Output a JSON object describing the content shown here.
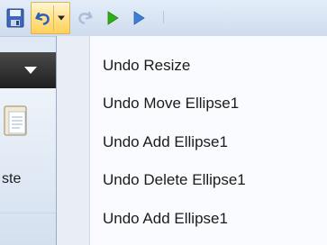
{
  "toolbar": {
    "buttons": [
      {
        "name": "save",
        "icon": "floppy-disk-icon"
      },
      {
        "name": "undo",
        "icon": "undo-arrow-icon",
        "state": "pressed"
      },
      {
        "name": "undo-dropdown",
        "icon": "chevron-down-icon"
      },
      {
        "name": "redo",
        "icon": "redo-arrow-icon",
        "state": "disabled"
      },
      {
        "name": "run",
        "icon": "play-green-icon"
      },
      {
        "name": "step",
        "icon": "play-blue-icon"
      }
    ]
  },
  "ribbon": {
    "paste_label": "ste"
  },
  "undo_menu": {
    "items": [
      {
        "label": "Undo Resize"
      },
      {
        "label": "Undo Move Ellipse1"
      },
      {
        "label": "Undo Add Ellipse1"
      },
      {
        "label": "Undo Delete Ellipse1"
      },
      {
        "label": "Undo Add Ellipse1"
      }
    ]
  },
  "colors": {
    "toolbar_bg": "#dbe6f4",
    "pressed_button": "#ffd15a",
    "menu_bg": "#f9fbfe",
    "menu_gutter": "#e9eef6",
    "run_green": "#2fae1a",
    "step_blue": "#3b7fd9"
  }
}
